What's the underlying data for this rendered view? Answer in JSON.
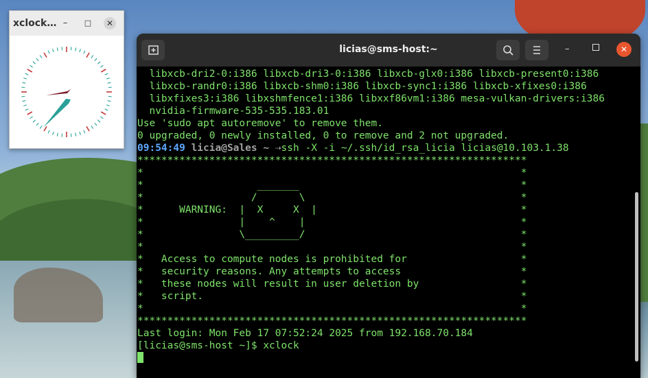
{
  "xclock": {
    "title": "xclock…",
    "min_glyph": "–",
    "max_glyph": "□",
    "close_glyph": "✕"
  },
  "terminal": {
    "title": "licias@sms-host:~",
    "icons": {
      "new_tab": "new-tab-icon",
      "search": "search-icon",
      "menu": "hamburger-menu-icon"
    },
    "min_glyph": "–",
    "close_glyph": "✕",
    "lines": [
      "  libxcb-dri2-0:i386 libxcb-dri3-0:i386 libxcb-glx0:i386 libxcb-present0:i386",
      "  libxcb-randr0:i386 libxcb-shm0:i386 libxcb-sync1:i386 libxcb-xfixes0:i386",
      "  libxfixes3:i386 libxshmfence1:i386 libxxf86vm1:i386 mesa-vulkan-drivers:i386",
      "  nvidia-firmware-535-535.183.01",
      "Use 'sudo apt autoremove' to remove them.",
      "0 upgraded, 0 newly installed, 0 to remove and 2 not upgraded."
    ],
    "prompt": {
      "time": "09:54:49",
      "user": "licia@Sales",
      "dir": "~",
      "arrow": "⇢",
      "command": "ssh -X -i ~/.ssh/id_rsa_licia licias@10.103.1.38"
    },
    "banner": [
      "*****************************************************************",
      "*                                                               *",
      "*                   _______                                     *",
      "*                  /       \\                                    *",
      "*      WARNING:  |  X     X  |                                  *",
      "*                |    ^    |                                    *",
      "*                \\_________/                                    *",
      "*                                                               *",
      "*   Access to compute nodes is prohibited for                   *",
      "*   security reasons. Any attempts to access                    *",
      "*   these nodes will result in user deletion by                 *",
      "*   script.                                                     *",
      "*                                                               *",
      "*****************************************************************"
    ],
    "last_login": "Last login: Mon Feb 17 07:52:24 2025 from 192.168.70.184",
    "current_prompt": "[licias@sms-host ~]$ xclock"
  },
  "colors": {
    "terminal_text": "#7fe36b",
    "prompt_time": "#5ea8ff",
    "close_button": "#e8552e"
  }
}
